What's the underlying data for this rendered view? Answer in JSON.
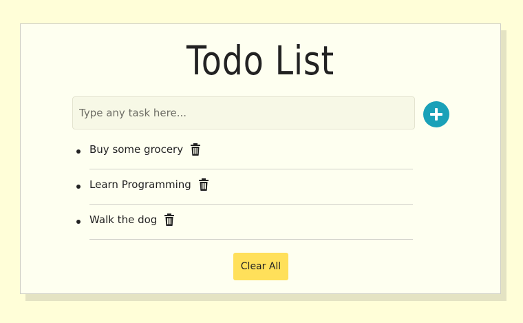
{
  "app": {
    "title": "Todo List"
  },
  "input": {
    "placeholder": "Type any task here...",
    "value": ""
  },
  "add_button": {
    "icon": "plus-icon",
    "color": "#1aa1b8"
  },
  "tasks": [
    {
      "text": "Buy some grocery",
      "icon": "trash-icon"
    },
    {
      "text": "Learn Programming",
      "icon": "trash-icon"
    },
    {
      "text": "Walk the dog",
      "icon": "trash-icon"
    }
  ],
  "clear_button": {
    "label": "Clear All",
    "color": "#ffe05a"
  },
  "colors": {
    "page_background": "#fffed8",
    "card_background": "#fefff0",
    "card_shadow": "#e4e3c3",
    "input_background": "#f7f8e6"
  }
}
